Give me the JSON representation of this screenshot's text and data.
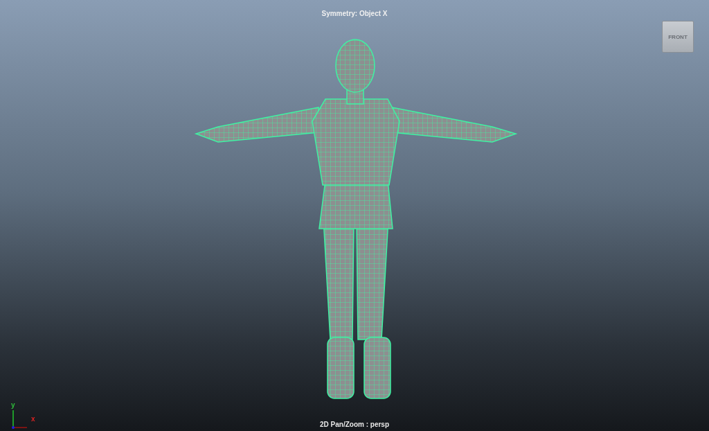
{
  "viewport": {
    "hud_message": "Symmetry: Object X",
    "camera_label": "2D Pan/Zoom : persp",
    "view_cube": {
      "face_label": "FRONT"
    },
    "axis_indicator": {
      "y_label": "y",
      "x_label": "x"
    }
  }
}
